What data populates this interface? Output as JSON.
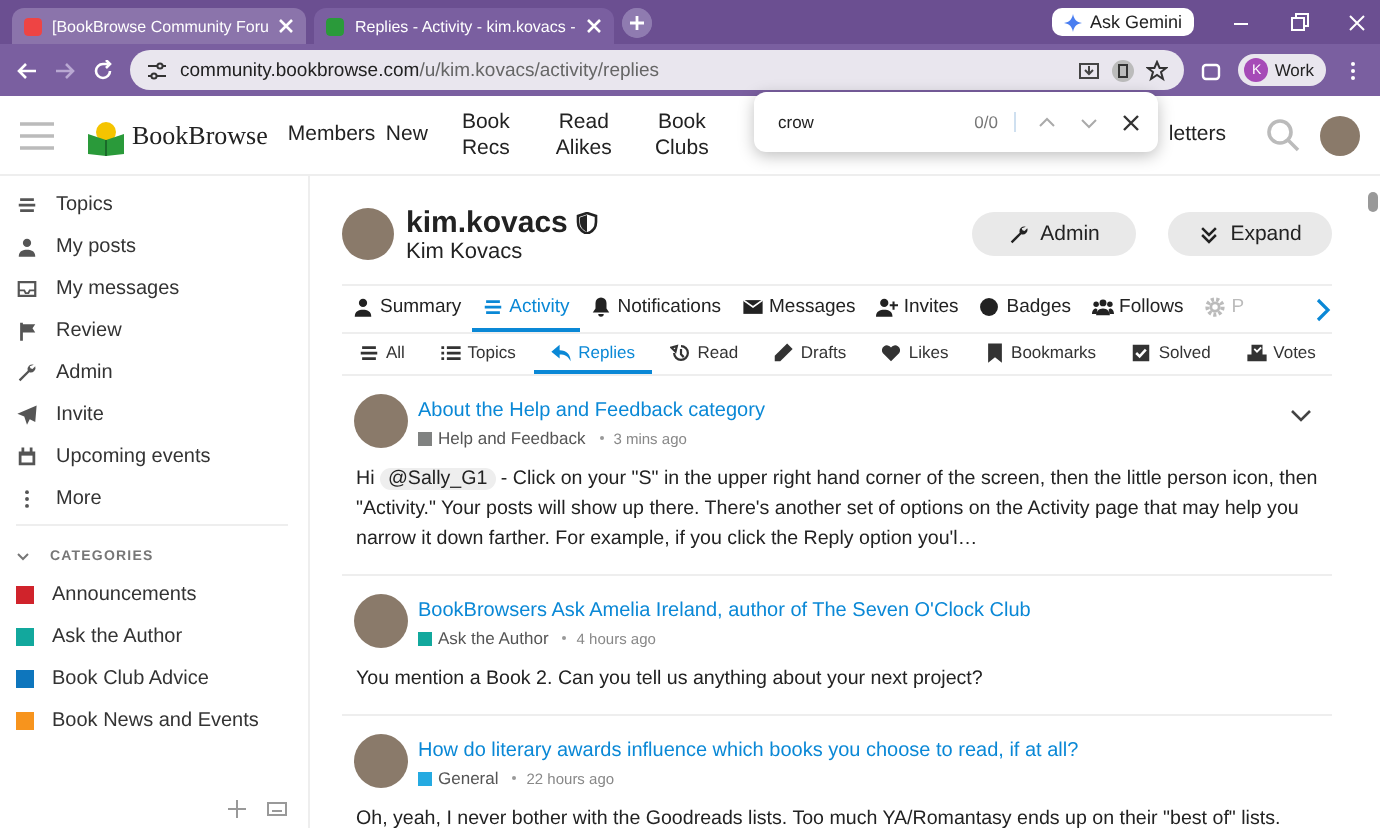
{
  "browser": {
    "tabs": [
      {
        "title": "[BookBrowse Community Foru",
        "selected": false
      },
      {
        "title": "Replies - Activity - kim.kovacs -",
        "selected": true
      }
    ],
    "ask_button": "Ask Gemini",
    "url_host": "community.bookbrowse.com",
    "url_path": "/u/kim.kovacs/activity/replies",
    "profile_initial": "K",
    "profile_label": "Work"
  },
  "find_bar": {
    "value": "crow",
    "count": "0/0"
  },
  "site": {
    "logo": "BookBrowse",
    "nav": [
      "Members",
      "New",
      "Book Recs",
      "Read Alikes",
      "Book Clubs"
    ],
    "nav_partial": "letters"
  },
  "sidebar": {
    "items": [
      {
        "label": "Topics"
      },
      {
        "label": "My posts"
      },
      {
        "label": "My messages"
      },
      {
        "label": "Review"
      },
      {
        "label": "Admin"
      },
      {
        "label": "Invite"
      },
      {
        "label": "Upcoming events"
      },
      {
        "label": "More"
      }
    ],
    "categories_heading": "CATEGORIES",
    "categories": [
      {
        "label": "Announcements",
        "color": "#d0232b"
      },
      {
        "label": "Ask the Author",
        "color": "#12a89d"
      },
      {
        "label": "Book Club Advice",
        "color": "#0e76bd"
      },
      {
        "label": "Book News and Events",
        "color": "#f7941d"
      }
    ]
  },
  "profile": {
    "username": "kim.kovacs",
    "full_name": "Kim Kovacs",
    "buttons": [
      {
        "label": "Admin"
      },
      {
        "label": "Expand"
      }
    ],
    "tabs": [
      {
        "label": "Summary",
        "selected": false
      },
      {
        "label": "Activity",
        "selected": true
      },
      {
        "label": "Notifications",
        "selected": false
      },
      {
        "label": "Messages",
        "selected": false
      },
      {
        "label": "Invites",
        "selected": false
      },
      {
        "label": "Badges",
        "selected": false
      },
      {
        "label": "Follows",
        "selected": false
      },
      {
        "label": "P",
        "selected": false
      }
    ],
    "subtabs": [
      {
        "label": "All",
        "selected": false
      },
      {
        "label": "Topics",
        "selected": false
      },
      {
        "label": "Replies",
        "selected": true
      },
      {
        "label": "Read",
        "selected": false
      },
      {
        "label": "Drafts",
        "selected": false
      },
      {
        "label": "Likes",
        "selected": false
      },
      {
        "label": "Bookmarks",
        "selected": false
      },
      {
        "label": "Solved",
        "selected": false
      },
      {
        "label": "Votes",
        "selected": false
      }
    ]
  },
  "posts": [
    {
      "title": "About the Help and Feedback category",
      "category": "Help and Feedback",
      "color": "#808281",
      "time": "3 mins ago",
      "menu": true,
      "excerpt": [
        {
          "kind": "text",
          "text": "Hi "
        },
        {
          "kind": "mention",
          "text": "@Sally_G1"
        },
        {
          "kind": "text",
          "text": " - Click on your \"S\" in the upper right hand corner of the screen, then the little person icon, then \"Activity.\" Your posts will show up there. There's another set of options on the Activity page that may help you narrow it down farther. For example, if you click the Reply option you'l…"
        }
      ]
    },
    {
      "title": "BookBrowsers Ask Amelia Ireland, author of The Seven O'Clock Club",
      "category": "Ask the Author",
      "color": "#12a89d",
      "time": "4 hours ago",
      "menu": false,
      "excerpt": [
        {
          "kind": "text",
          "text": "You mention a Book 2. Can you tell us anything about your next project?"
        }
      ]
    },
    {
      "title": "How do literary awards influence which books you choose to read, if at all?",
      "category": "General",
      "color": "#25aae1",
      "time": "22 hours ago",
      "menu": false,
      "excerpt": [
        {
          "kind": "text",
          "text": "Oh, yeah, I never bother with the Goodreads lists. Too much YA/Romantasy ends up on their \"best of\" lists."
        }
      ]
    }
  ]
}
